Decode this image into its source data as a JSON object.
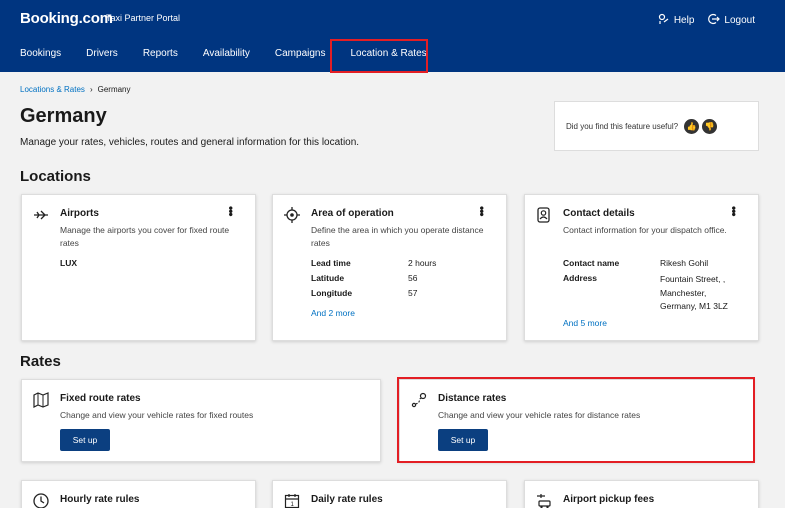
{
  "header": {
    "brand": "Booking.com",
    "brand_sub": "Taxi Partner Portal",
    "help": "Help",
    "logout": "Logout",
    "nav": [
      "Bookings",
      "Drivers",
      "Reports",
      "Availability",
      "Campaigns",
      "Location & Rates"
    ]
  },
  "breadcrumb": {
    "parent": "Locations & Rates",
    "current": "Germany"
  },
  "page": {
    "title": "Germany",
    "subtitle": "Manage your rates, vehicles, routes and general information for this location."
  },
  "feedback": {
    "question": "Did you find this feature useful?"
  },
  "locations": {
    "heading": "Locations",
    "airports": {
      "title": "Airports",
      "desc": "Manage the airports you cover for fixed route rates",
      "value": "LUX"
    },
    "area": {
      "title": "Area of operation",
      "desc": "Define the area in which you operate distance rates",
      "rows": [
        {
          "k": "Lead time",
          "v": "2 hours"
        },
        {
          "k": "Latitude",
          "v": "56"
        },
        {
          "k": "Longitude",
          "v": "57"
        }
      ],
      "more": "And 2 more"
    },
    "contact": {
      "title": "Contact details",
      "desc": "Contact information for your dispatch office.",
      "name_k": "Contact name",
      "name_v": "Rikesh Gohil",
      "addr_k": "Address",
      "addr_lines": [
        "Fountain Street, ,",
        "Manchester,",
        "Germany, M1 3LZ"
      ],
      "more": "And 5 more"
    }
  },
  "rates": {
    "heading": "Rates",
    "fixed": {
      "title": "Fixed route rates",
      "desc": "Change and view your vehicle rates for fixed routes",
      "button": "Set up"
    },
    "distance": {
      "title": "Distance rates",
      "desc": "Change and view your vehicle rates for distance rates",
      "button": "Set up"
    },
    "hourly": {
      "title": "Hourly rate rules"
    },
    "daily": {
      "title": "Daily rate rules"
    },
    "pickup": {
      "title": "Airport pickup fees"
    }
  },
  "colors": {
    "brand": "#003580",
    "link": "#0071c2",
    "button": "#0b3f80",
    "highlight": "#e31e24"
  }
}
